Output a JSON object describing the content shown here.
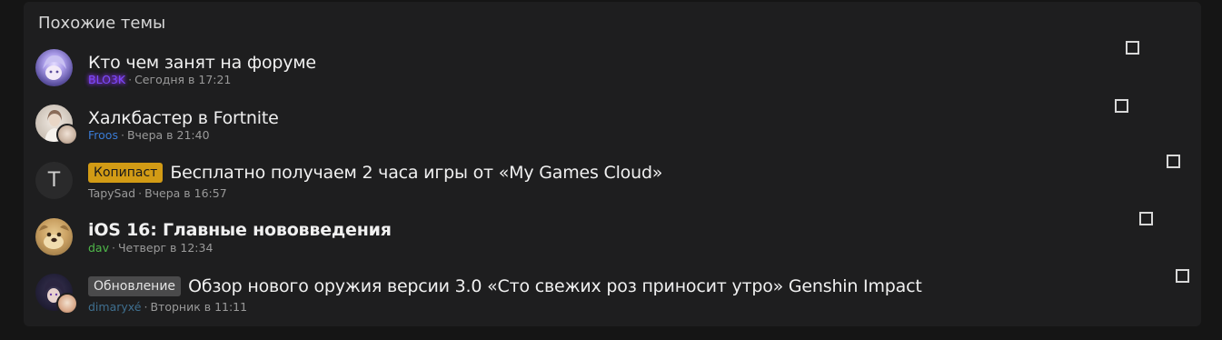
{
  "panel": {
    "title": "Похожие темы"
  },
  "threads": [
    {
      "prefix": "",
      "title": "Кто чем занят на форуме",
      "user": "BLO3K",
      "user_color": "#7b4bff",
      "separator": "·",
      "time": "Сегодня в 17:21",
      "avatar_icon": "anime-avatar"
    },
    {
      "prefix": "",
      "title": "Халкбастер в Fortnite",
      "user": "Froos",
      "user_color": "#3a7bd5",
      "separator": "·",
      "time": "Вчера в 21:40",
      "avatar_icon": "photo-avatar"
    },
    {
      "prefix": "Копипаст",
      "title": "Бесплатно получаем 2 часа игры от «My Games Cloud»",
      "user": "TapySad",
      "user_color": "#9a9a9a",
      "separator": "·",
      "time": "Вчера в 16:57",
      "avatar_letter": "T"
    },
    {
      "prefix": "",
      "title": "iOS 16: Главные нововведения",
      "user": "dav",
      "user_color": "#4fb84a",
      "separator": "·",
      "time": "Четверг в 12:34",
      "avatar_icon": "dog-avatar"
    },
    {
      "prefix": "Обновление",
      "title": "Обзор нового оружия версии 3.0 «Сто свежих роз приносит утро» Genshin Impact",
      "user": "dimaryxé",
      "user_color": "#3f6f8f",
      "separator": "·",
      "time": "Вторник в 11:11",
      "avatar_icon": "anime-avatar-2"
    }
  ]
}
